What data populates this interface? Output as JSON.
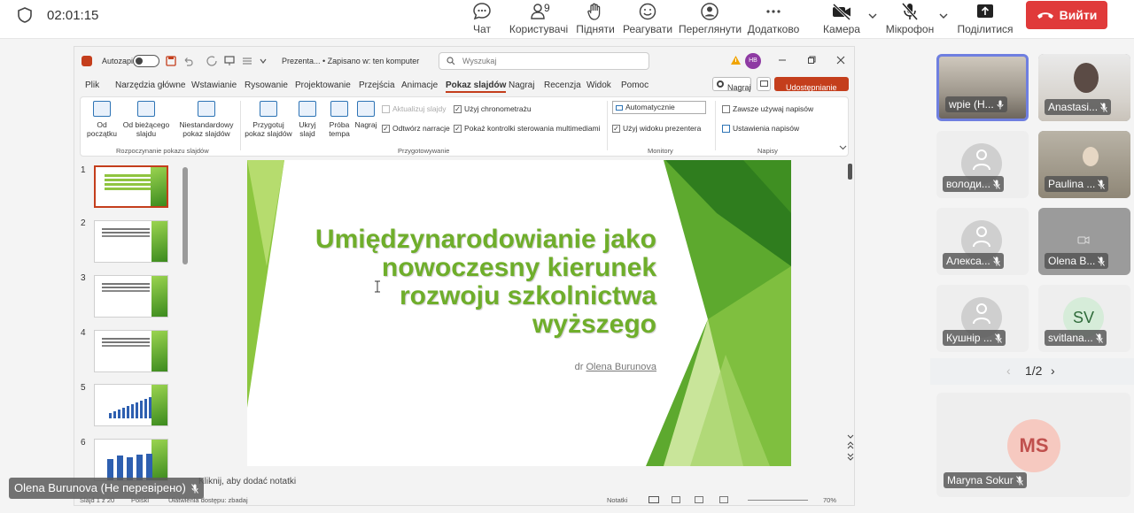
{
  "meeting": {
    "timer": "02:01:15",
    "toolbar": {
      "chat": "Чат",
      "users": "Користувачі",
      "users_count": "9",
      "raise": "Підняти",
      "react": "Реагувати",
      "view": "Переглянути",
      "more": "Додатково",
      "camera": "Камера",
      "mic": "Мікрофон",
      "share": "Поділитися",
      "leave": "Вийти"
    },
    "presenter_label": "Olena Burunova (Не перевірено)"
  },
  "ppt": {
    "autosave": "Autozapis",
    "file_title": "Prezenta... • Zapisano w: ten komputer",
    "search_placeholder": "Wyszukaj",
    "user_initials": "HB",
    "menu": [
      "Plik",
      "Narzędzia główne",
      "Wstawianie",
      "Rysowanie",
      "Projektowanie",
      "Przejścia",
      "Animacje",
      "Pokaz slajdów",
      "Nagraj",
      "Recenzja",
      "Widok",
      "Pomoc"
    ],
    "record_btn": "Nagraj",
    "share_btn": "Udostępnianie",
    "ribbon": {
      "from_start": [
        "Od",
        "początku"
      ],
      "from_current": [
        "Od bieżącego",
        "slajdu"
      ],
      "custom": [
        "Niestandardowy",
        "pokaz slajdów"
      ],
      "group1": "Rozpoczynanie pokazu slajdów",
      "prepare": [
        "Przygotuj",
        "pokaz slajdów"
      ],
      "hide": [
        "Ukryj",
        "slajd"
      ],
      "rehearse": [
        "Próba",
        "tempa"
      ],
      "record": "Nagraj",
      "update_slides": "Aktualizuj slajdy",
      "play_narration": "Odtwórz narracje",
      "use_timings": "Użyj chronometrażu",
      "show_controls": "Pokaż kontrolki sterowania multimediami",
      "group2": "Przygotowywanie",
      "monitor_select": "Automatycznie",
      "presenter_view": "Użyj widoku prezentera",
      "group3": "Monitory",
      "always_subtitles": "Zawsze używaj napisów",
      "subtitle_settings": "Ustawienia napisów",
      "group4": "Napisy"
    },
    "slide_numbers": [
      "1",
      "2",
      "3",
      "4",
      "5",
      "6"
    ],
    "slide": {
      "title_lines": [
        "Umiędzynarodowianie jako",
        "nowoczesny kierunek",
        "rozwoju szkolnictwa",
        "wyższego"
      ],
      "author_prefix": "dr",
      "author_name": "Olena Burunova"
    },
    "notes_placeholder": "Kliknij, aby dodać notatki",
    "status": {
      "slide_of": "Slajd 1 z 20",
      "language": "Polski",
      "accessibility": "Ułatwienia dostępu: zbadaj",
      "notes": "Notatki",
      "zoom": "70%"
    }
  },
  "participants": [
    {
      "name": "wpie (Н...",
      "type": "video"
    },
    {
      "name": "Anastasi...",
      "type": "video"
    },
    {
      "name": "володи...",
      "type": "avatar"
    },
    {
      "name": "Paulina ...",
      "type": "video"
    },
    {
      "name": "Алекса...",
      "type": "avatar"
    },
    {
      "name": "Olena B...",
      "type": "video"
    },
    {
      "name": "Кушнір ...",
      "type": "avatar"
    },
    {
      "name": "svitlana...",
      "type": "initials",
      "initials": "SV"
    }
  ],
  "pager": "1/2",
  "highlight_participant": {
    "name": "Maryna Sokur",
    "initials": "MS"
  },
  "colors": {
    "leave": "#e03a3a",
    "accent_green": "#6fae2b",
    "ppt_orange": "#c43e1c",
    "active_border": "#6f7fe0"
  }
}
